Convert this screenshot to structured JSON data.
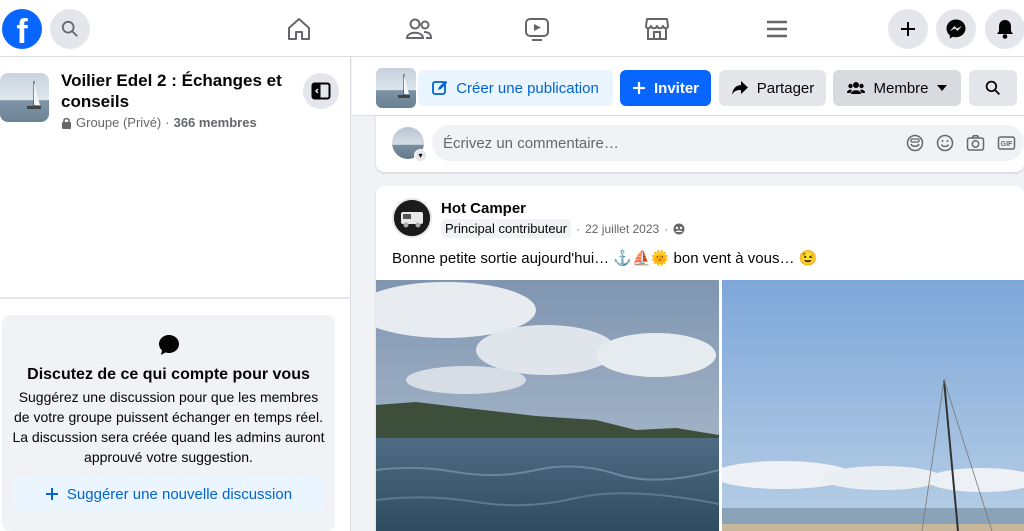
{
  "topbar": {
    "logo_letter": "f",
    "nav": [
      "home-icon",
      "friends-icon",
      "video-icon",
      "marketplace-icon",
      "menu-icon"
    ],
    "right": [
      "plus-icon",
      "messenger-icon",
      "bell-icon"
    ],
    "active_color": "#0866ff"
  },
  "sidebar": {
    "group_name": "Voilier Edel 2 : Échanges et conseils",
    "privacy": "Groupe (Privé)",
    "separator": "·",
    "members": "366 membres",
    "promo": {
      "title": "Discutez de ce qui compte pour vous",
      "text": "Suggérez une discussion pour que les membres de votre groupe puissent échanger en temps réel. La discussion sera créée quand les admins auront approuvé votre suggestion.",
      "button": "Suggérer une nouvelle discussion"
    }
  },
  "actionbar": {
    "create": "Créer une publication",
    "invite": "Inviter",
    "share": "Partager",
    "member": "Membre"
  },
  "comment": {
    "placeholder": "Écrivez un commentaire…"
  },
  "post": {
    "author": "Hot Camper",
    "badge": "Principal contributeur",
    "date": "22 juillet 2023",
    "separator": "·",
    "text": "Bonne petite sortie aujourd'hui… ⚓⛵🌞 bon vent à vous… 😉"
  }
}
